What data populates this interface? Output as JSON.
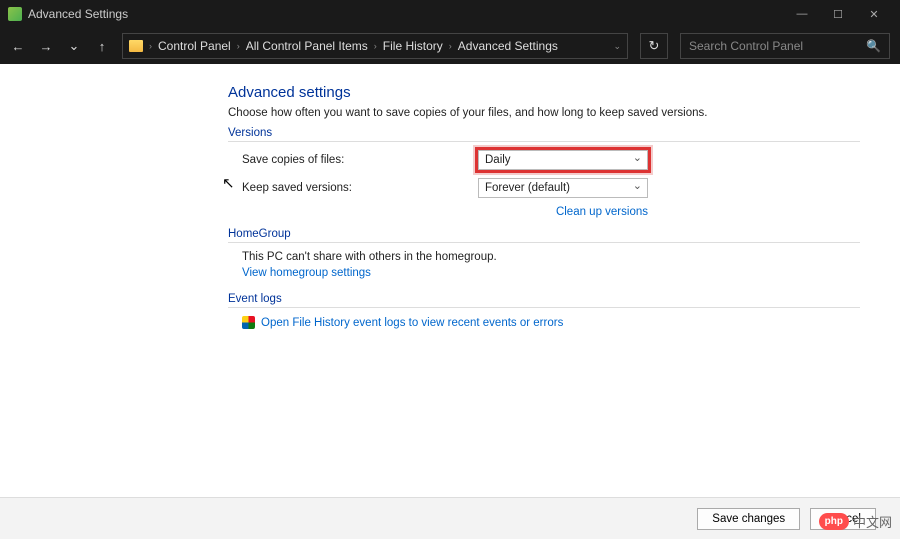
{
  "window": {
    "title": "Advanced Settings"
  },
  "breadcrumbs": {
    "b0": "Control Panel",
    "b1": "All Control Panel Items",
    "b2": "File History",
    "b3": "Advanced Settings"
  },
  "search": {
    "placeholder": "Search Control Panel"
  },
  "page": {
    "heading": "Advanced settings",
    "description": "Choose how often you want to save copies of your files, and how long to keep saved versions."
  },
  "versions": {
    "section_label": "Versions",
    "save_copies_label": "Save copies of files:",
    "save_copies_value": "Daily",
    "keep_saved_label": "Keep saved versions:",
    "keep_saved_value": "Forever (default)",
    "cleanup_link": "Clean up versions"
  },
  "homegroup": {
    "section_label": "HomeGroup",
    "text": "This PC can't share with others in the homegroup.",
    "link": "View homegroup settings"
  },
  "eventlogs": {
    "section_label": "Event logs",
    "link": "Open File History event logs to view recent events or errors"
  },
  "footer": {
    "save": "Save changes",
    "cancel": "Cancel"
  },
  "watermark": {
    "logo": "php",
    "text": "中文网"
  }
}
